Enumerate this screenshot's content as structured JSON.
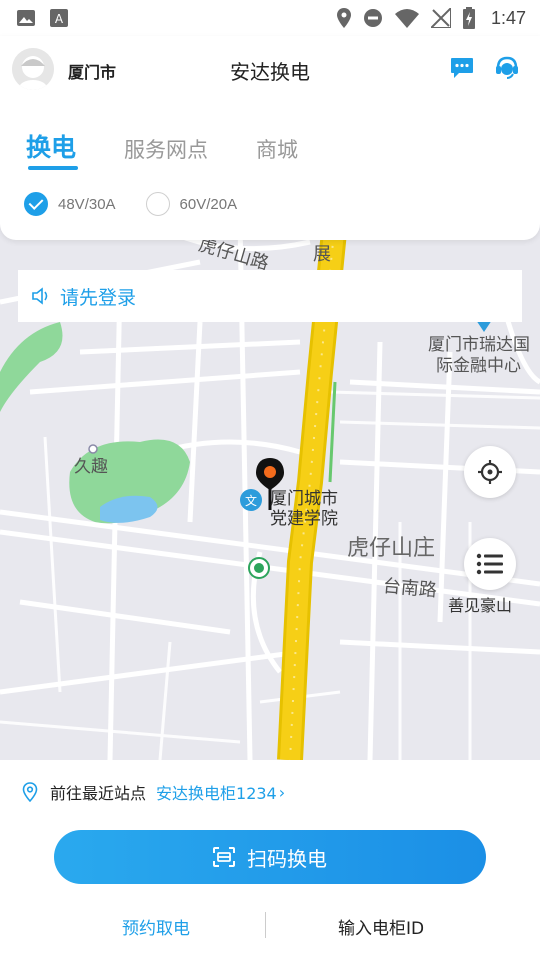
{
  "status_bar": {
    "time": "1:47"
  },
  "header": {
    "city": "厦门市",
    "title": "安达换电"
  },
  "tabs": [
    {
      "label": "换电",
      "active": true
    },
    {
      "label": "服务网点",
      "active": false
    },
    {
      "label": "商城",
      "active": false
    }
  ],
  "specs": [
    {
      "label": "48V/30A",
      "checked": true
    },
    {
      "label": "60V/20A",
      "checked": false
    }
  ],
  "login_banner": {
    "text": "请先登录"
  },
  "map": {
    "labels": {
      "road_top": "虎仔山路",
      "road_vertical": "展",
      "finance_center_1": "厦门市瑞达国",
      "finance_center_2": "际金融中心",
      "jiuqu": "久趣",
      "party_school_1": "厦门城市",
      "party_school_2": "党建学院",
      "huzai_villa": "虎仔山庄",
      "tainan_road": "台南路",
      "shanjian": "善见豪山"
    }
  },
  "nearest": {
    "label": "前往最近站点",
    "station": "安达换电柜1234",
    "chevron": "›"
  },
  "actions": {
    "scan_label": "扫码换电",
    "reserve_label": "预约取电",
    "input_label": "输入电柜ID"
  },
  "colors": {
    "accent": "#1e9fe8",
    "road_main": "#f6cf16",
    "park": "#8fd89a",
    "water": "#7cc4ef"
  }
}
